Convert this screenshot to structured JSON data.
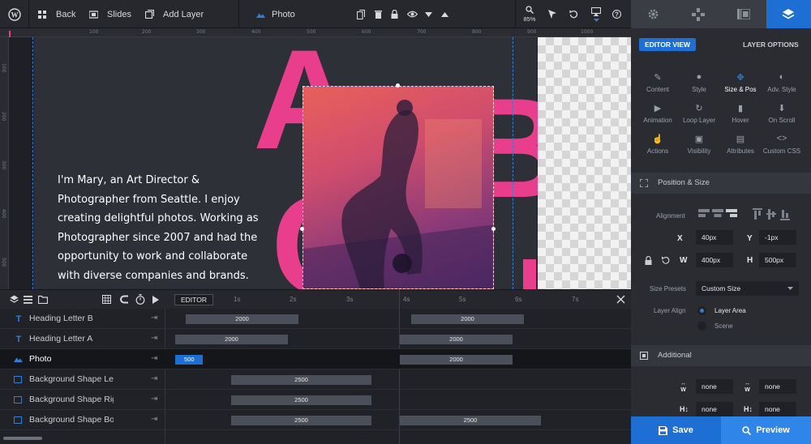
{
  "toolbar": {
    "back_label": "Back",
    "slides_label": "Slides",
    "add_layer_label": "Add Layer",
    "layer_name": "Photo",
    "zoom": "85%"
  },
  "ruler": {
    "ticks": [
      "100",
      "200",
      "300",
      "400",
      "500",
      "600",
      "700",
      "800",
      "900",
      "1000"
    ],
    "left_ticks": [
      "100",
      "200",
      "300",
      "400",
      "500"
    ]
  },
  "canvas": {
    "letters": [
      "A",
      "B",
      "C"
    ],
    "bio_lines": [
      "I'm Mary, an Art Director &",
      "Photographer from Seattle. I enjoy",
      "creating delightful photos. Working as",
      "Photographer since 2007 and had the",
      "opportunity to work and collaborate",
      "with diverse companies and brands."
    ],
    "accent": "#e83e8c"
  },
  "timeline": {
    "editor_label": "EDITOR",
    "seconds": [
      "1s",
      "2s",
      "3s",
      "4s",
      "5s",
      "6s",
      "7s"
    ],
    "rows": [
      {
        "icon": "text-icon",
        "label": "Heading Letter B",
        "bars": [
          {
            "v": "2000"
          },
          {
            "v": "2000"
          }
        ]
      },
      {
        "icon": "text-icon",
        "label": "Heading Letter A",
        "bars": [
          {
            "v": "2000"
          },
          {
            "v": "2000"
          }
        ]
      },
      {
        "icon": "image-icon",
        "label": "Photo",
        "bars": [
          {
            "v": "500"
          },
          {
            "v": "2000"
          }
        ]
      },
      {
        "icon": "shape-icon",
        "label": "Background Shape Left",
        "bars": [
          {
            "v": "2500"
          }
        ]
      },
      {
        "icon": "shape-icon",
        "label": "Background Shape Right",
        "bars": [
          {
            "v": "2500"
          }
        ]
      },
      {
        "icon": "shape-icon",
        "label": "Background Shape Bottom",
        "bars": [
          {
            "v": "2500"
          },
          {
            "v": "2500"
          }
        ]
      }
    ]
  },
  "sidebar": {
    "editor_view": "EDITOR VIEW",
    "layer_options": "LAYER OPTIONS",
    "options": [
      {
        "label": "Content",
        "icon": "pencil-icon"
      },
      {
        "label": "Style",
        "icon": "palette-icon"
      },
      {
        "label": "Size & Pos",
        "icon": "move-icon"
      },
      {
        "label": "Adv. Style",
        "icon": "contrast-icon"
      },
      {
        "label": "Animation",
        "icon": "play-icon"
      },
      {
        "label": "Loop Layer",
        "icon": "loop-icon"
      },
      {
        "label": "Hover",
        "icon": "mouse-icon"
      },
      {
        "label": "On Scroll",
        "icon": "scroll-icon"
      },
      {
        "label": "Actions",
        "icon": "hand-icon"
      },
      {
        "label": "Visibility",
        "icon": "visibility-icon"
      },
      {
        "label": "Attributes",
        "icon": "file-icon"
      },
      {
        "label": "Custom CSS",
        "icon": "code-icon"
      }
    ],
    "position_size_title": "Position & Size",
    "alignment_label": "Alignment",
    "x_label": "X",
    "x_value": "40px",
    "y_label": "Y",
    "y_value": "-1px",
    "w_label": "W",
    "w_value": "400px",
    "h_label": "H",
    "h_value": "500px",
    "size_presets_label": "Size Presets",
    "size_presets_value": "Custom Size",
    "layer_align_label": "Layer Align",
    "layer_align_options": [
      "Layer Area",
      "Scene"
    ],
    "additional_title": "Additional",
    "add_values": [
      "none",
      "none",
      "none",
      "none"
    ],
    "save_label": "Save",
    "preview_label": "Preview",
    "active_color": "#1e6fd3"
  }
}
